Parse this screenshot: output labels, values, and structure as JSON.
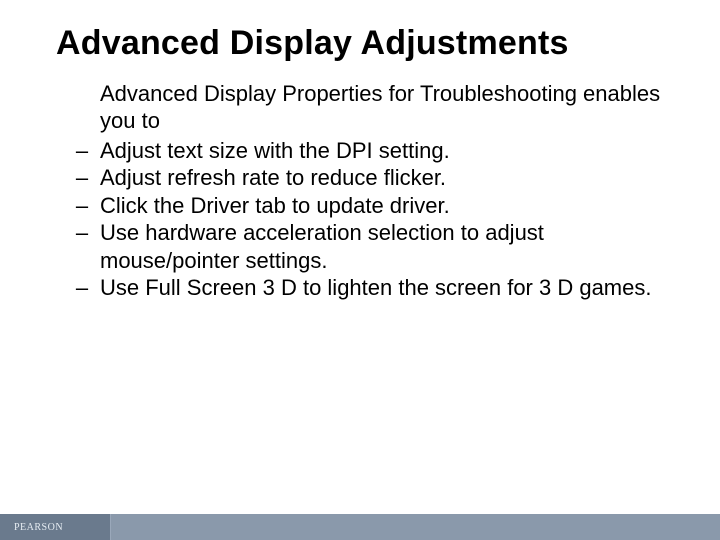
{
  "title": "Advanced Display Adjustments",
  "lead": "Advanced Display Properties for Troubleshooting enables you to",
  "bullets": [
    "Adjust text size with the DPI setting.",
    "Adjust refresh rate to reduce flicker.",
    "Click the Driver tab to update driver.",
    "Use hardware acceleration selection to adjust mouse/pointer settings.",
    "Use Full Screen 3 D to lighten the screen for 3 D games."
  ],
  "brand": "PEARSON"
}
